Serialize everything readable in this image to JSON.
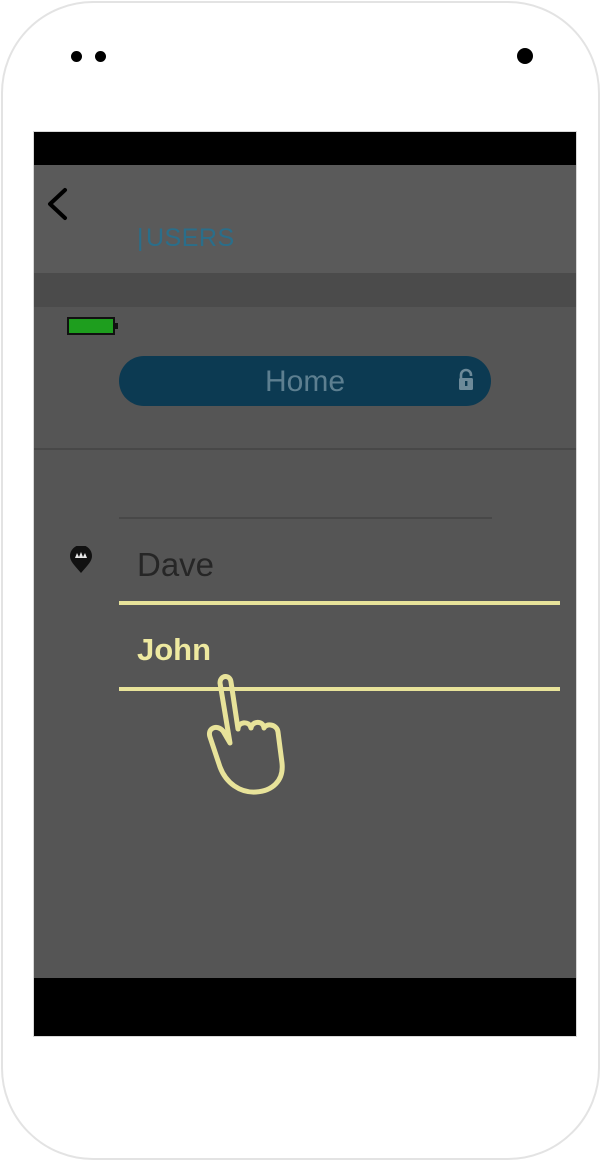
{
  "header": {
    "separator": "|",
    "title": "USERS"
  },
  "icons": {
    "back": "chevron-left-icon",
    "battery": "battery-full-icon",
    "lock": "lock-icon",
    "pin": "map-pin-icon",
    "hand": "tap-hand-icon"
  },
  "location_selector": {
    "label": "Home"
  },
  "users": [
    {
      "name": "Dave"
    },
    {
      "name": "John"
    }
  ],
  "colors": {
    "accent": "#0c3a52",
    "highlight": "#e8e39a",
    "title": "#2a6e8a",
    "battery": "#1e9e1e"
  }
}
